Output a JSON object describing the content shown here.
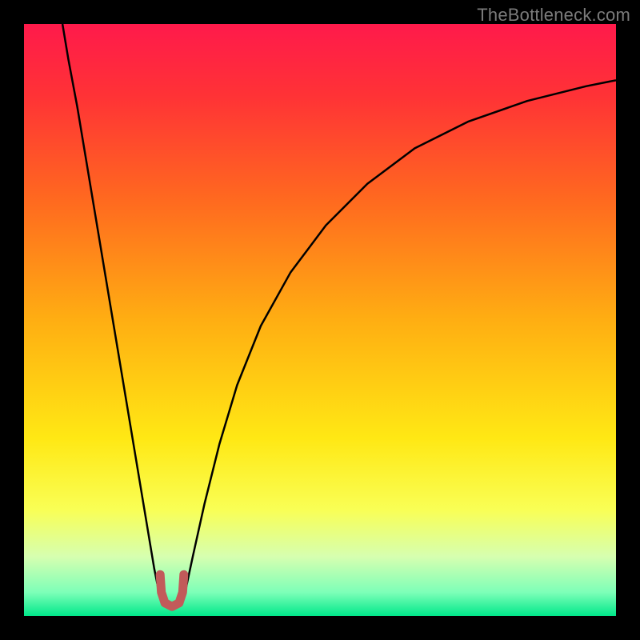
{
  "branding": {
    "watermark": "TheBottleneck.com"
  },
  "chart_data": {
    "type": "line",
    "title": "",
    "xlabel": "",
    "ylabel": "",
    "xlim": [
      0,
      100
    ],
    "ylim": [
      0,
      100
    ],
    "grid": false,
    "background": {
      "stops": [
        {
          "offset": 0.0,
          "color": "#ff1a4b"
        },
        {
          "offset": 0.12,
          "color": "#ff3236"
        },
        {
          "offset": 0.3,
          "color": "#ff6a1f"
        },
        {
          "offset": 0.5,
          "color": "#ffae12"
        },
        {
          "offset": 0.7,
          "color": "#ffe814"
        },
        {
          "offset": 0.82,
          "color": "#f9ff55"
        },
        {
          "offset": 0.9,
          "color": "#d6ffb0"
        },
        {
          "offset": 0.96,
          "color": "#7dffb8"
        },
        {
          "offset": 1.0,
          "color": "#00e88a"
        }
      ]
    },
    "series": [
      {
        "name": "left-branch",
        "color": "#000000",
        "width": 2.5,
        "points": [
          {
            "x": 6.5,
            "y": 100.0
          },
          {
            "x": 7.5,
            "y": 94.0
          },
          {
            "x": 9.0,
            "y": 86.0
          },
          {
            "x": 10.5,
            "y": 77.0
          },
          {
            "x": 12.0,
            "y": 68.0
          },
          {
            "x": 13.5,
            "y": 59.0
          },
          {
            "x": 15.0,
            "y": 50.0
          },
          {
            "x": 16.5,
            "y": 41.0
          },
          {
            "x": 18.0,
            "y": 32.0
          },
          {
            "x": 19.5,
            "y": 23.0
          },
          {
            "x": 21.0,
            "y": 14.0
          },
          {
            "x": 22.0,
            "y": 8.0
          },
          {
            "x": 23.0,
            "y": 3.0
          }
        ]
      },
      {
        "name": "right-branch",
        "color": "#000000",
        "width": 2.5,
        "points": [
          {
            "x": 27.0,
            "y": 3.0
          },
          {
            "x": 28.5,
            "y": 10.0
          },
          {
            "x": 30.5,
            "y": 19.0
          },
          {
            "x": 33.0,
            "y": 29.0
          },
          {
            "x": 36.0,
            "y": 39.0
          },
          {
            "x": 40.0,
            "y": 49.0
          },
          {
            "x": 45.0,
            "y": 58.0
          },
          {
            "x": 51.0,
            "y": 66.0
          },
          {
            "x": 58.0,
            "y": 73.0
          },
          {
            "x": 66.0,
            "y": 79.0
          },
          {
            "x": 75.0,
            "y": 83.5
          },
          {
            "x": 85.0,
            "y": 87.0
          },
          {
            "x": 95.0,
            "y": 89.5
          },
          {
            "x": 100.0,
            "y": 90.5
          }
        ]
      },
      {
        "name": "marker-u",
        "color": "#c25a5a",
        "width": 11,
        "linecap": "round",
        "points": [
          {
            "x": 23.0,
            "y": 7.0
          },
          {
            "x": 23.2,
            "y": 4.0
          },
          {
            "x": 23.8,
            "y": 2.2
          },
          {
            "x": 25.0,
            "y": 1.6
          },
          {
            "x": 26.2,
            "y": 2.2
          },
          {
            "x": 26.8,
            "y": 4.0
          },
          {
            "x": 27.0,
            "y": 7.0
          }
        ]
      }
    ]
  }
}
